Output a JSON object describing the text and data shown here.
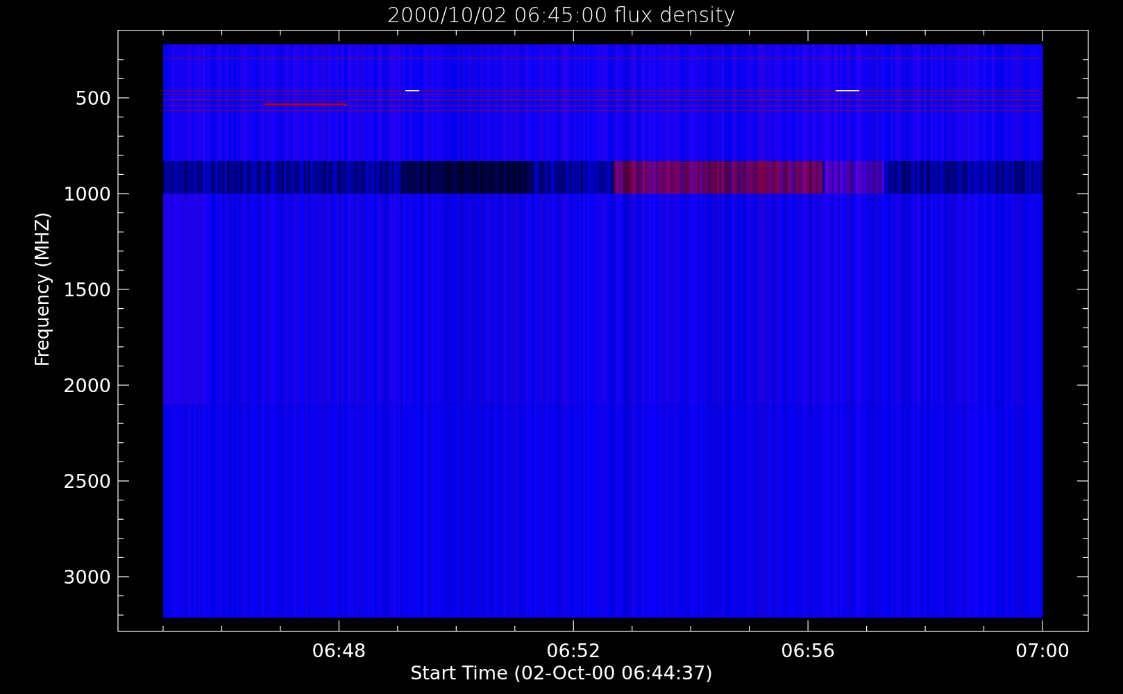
{
  "plot": {
    "title": "2000/10/02 06:45:00 flux density",
    "ylabel": "Frequency (MHZ)",
    "xlabel": "Start Time (02-Oct-00 06:44:37)",
    "yticks": [
      "500",
      "1000",
      "1500",
      "2000",
      "2500",
      "3000"
    ],
    "xticks": [
      "06:48",
      "06:52",
      "06:56",
      "07:00"
    ]
  }
}
